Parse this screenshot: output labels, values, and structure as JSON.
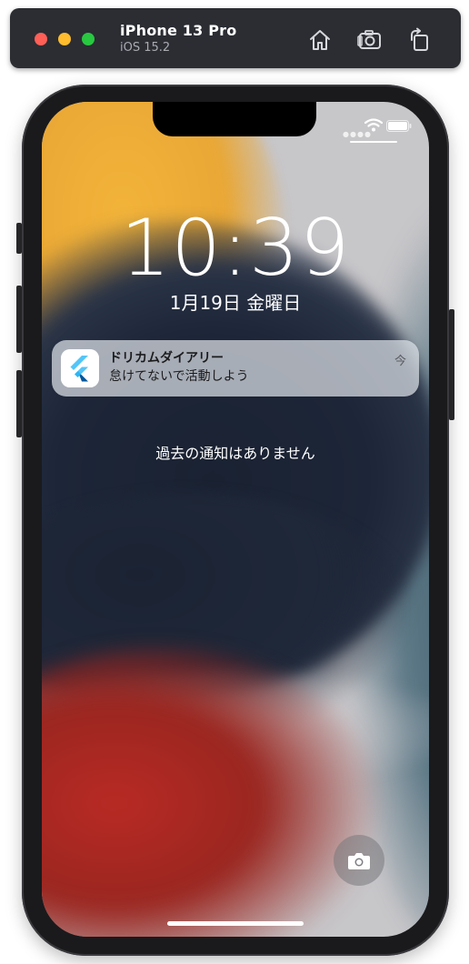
{
  "simulator": {
    "device_name": "iPhone 13 Pro",
    "os_version": "iOS 15.2",
    "toolbar_icons": [
      "home-icon",
      "screenshot-icon",
      "rotate-icon"
    ]
  },
  "lockscreen": {
    "time": "10:39",
    "date": "1月19日 金曜日",
    "no_older_notifications": "過去の通知はありません"
  },
  "notification": {
    "app_name": "ドリカムダイアリー",
    "message": "怠けてないで活動しよう",
    "time": "今",
    "app_icon": "flutter-logo-icon"
  },
  "colors": {
    "toolbar_bg": "#2b2d33",
    "red": "#ff5f57",
    "yellow": "#febc2e",
    "green": "#28c840",
    "wallpaper_orange": "#f3b43a",
    "wallpaper_navy": "#1d2638",
    "wallpaper_red": "#b92a24",
    "wallpaper_teal": "#4b6674"
  }
}
